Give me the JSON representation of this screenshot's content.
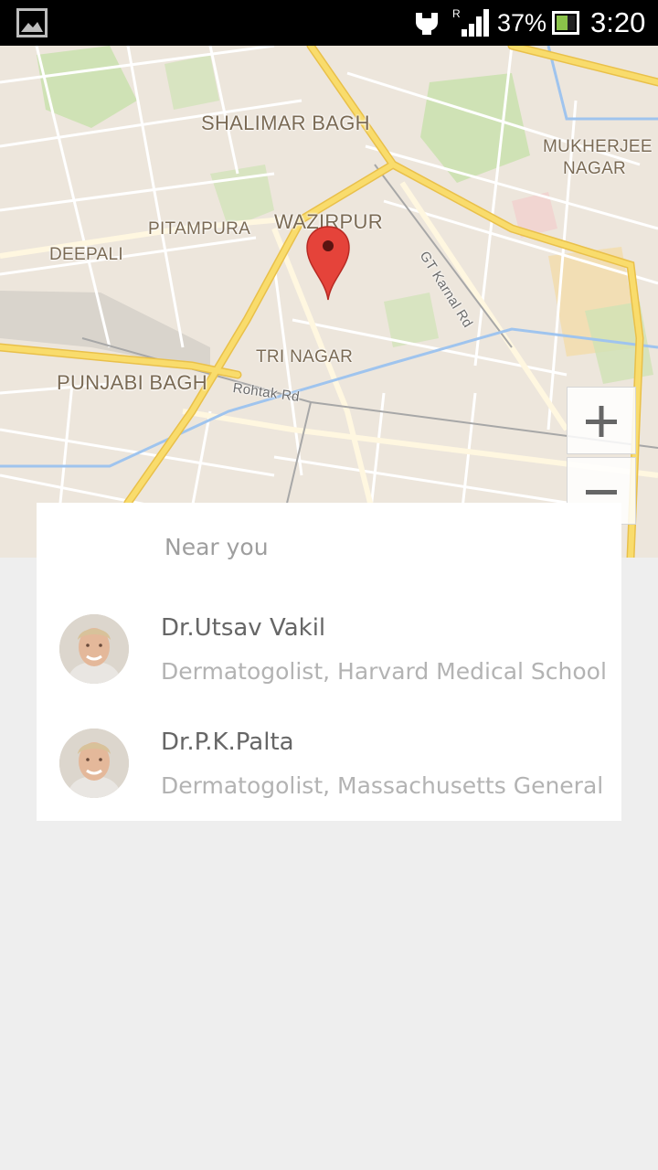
{
  "status_bar": {
    "battery_percent": "37%",
    "time": "3:20",
    "roaming_indicator": "R",
    "icons": [
      "gallery-icon",
      "usb-debug-icon",
      "signal-icon",
      "battery-icon"
    ]
  },
  "map": {
    "labels": {
      "shalimar_bagh": "SHALIMAR BAGH",
      "mukherjee_line1": "MUKHERJEE",
      "mukherjee_line2": "NAGAR",
      "wazirpur": "WAZIRPUR",
      "pitampura": "PITAMPURA",
      "deepali": "DEEPALI",
      "gt_karnal_road": "GT Karnal Rd",
      "tri_nagar": "TRI NAGAR",
      "punjabi_bagh": "PUNJABI BAGH",
      "rohtak_road": "Rohtak Rd"
    },
    "zoom_in_icon": "plus-icon",
    "zoom_out_icon": "minus-icon",
    "marker_icon": "location-pin-icon",
    "colors": {
      "land": "#ede6dc",
      "highway": "#f7d45e",
      "marker": "#e53935"
    }
  },
  "nearby": {
    "heading": "Near you",
    "doctors": [
      {
        "name": "Dr.Utsav Vakil",
        "subtitle": "Dermatogolist, Harvard Medical School"
      },
      {
        "name": "Dr.P.K.Palta",
        "subtitle": "Dermatogolist, Massachusetts General"
      }
    ]
  }
}
